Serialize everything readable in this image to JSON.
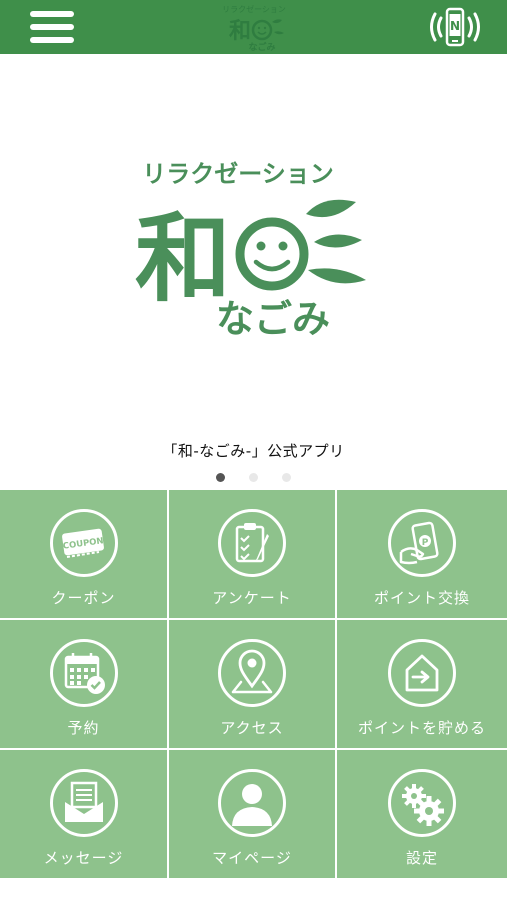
{
  "header": {
    "logo_text": "リラクゼーション 和 なごみ",
    "menu_icon": "hamburger-menu-icon",
    "nfc_icon": "nfc-phone-icon"
  },
  "hero": {
    "logo_lines": [
      "リラクゼーション",
      "和",
      "なごみ"
    ],
    "caption": "「和-なごみ-」公式アプリ",
    "carousel": {
      "count": 3,
      "active": 1
    }
  },
  "menu": [
    {
      "label": "クーポン",
      "icon": "coupon-icon"
    },
    {
      "label": "アンケート",
      "icon": "survey-clipboard-icon"
    },
    {
      "label": "ポイント交換",
      "icon": "point-exchange-icon"
    },
    {
      "label": "予約",
      "icon": "calendar-check-icon"
    },
    {
      "label": "アクセス",
      "icon": "map-pin-icon"
    },
    {
      "label": "ポイントを貯める",
      "icon": "point-checkin-icon"
    },
    {
      "label": "メッセージ",
      "icon": "message-inbox-icon"
    },
    {
      "label": "マイページ",
      "icon": "user-icon"
    },
    {
      "label": "設定",
      "icon": "gears-icon"
    }
  ],
  "colors": {
    "header": "#3f8f4a",
    "tile": "#8ec28c",
    "logo_green": "#4a8f5a",
    "white": "#ffffff"
  }
}
